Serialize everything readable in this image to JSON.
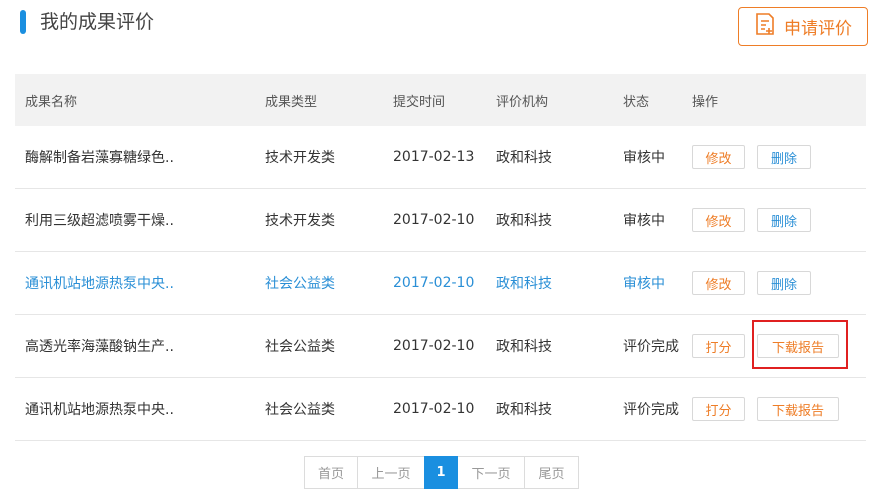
{
  "header": {
    "title": "我的成果评价",
    "apply_label": "申请评价"
  },
  "table": {
    "columns": [
      "成果名称",
      "成果类型",
      "提交时间",
      "评价机构",
      "状态",
      "操作"
    ],
    "rows": [
      {
        "name": "酶解制备岩藻寡糖绿色..",
        "type": "技术开发类",
        "date": "2017-02-13",
        "org": "政和科技",
        "status": "审核中",
        "actions": [
          "修改",
          "删除"
        ]
      },
      {
        "name": "利用三级超滤喷雾干燥..",
        "type": "技术开发类",
        "date": "2017-02-10",
        "org": "政和科技",
        "status": "审核中",
        "actions": [
          "修改",
          "删除"
        ]
      },
      {
        "name": "通讯机站地源热泵中央..",
        "type": "社会公益类",
        "date": "2017-02-10",
        "org": "政和科技",
        "status": "审核中",
        "actions": [
          "修改",
          "删除"
        ]
      },
      {
        "name": "高透光率海藻酸钠生产..",
        "type": "社会公益类",
        "date": "2017-02-10",
        "org": "政和科技",
        "status": "评价完成",
        "actions": [
          "打分",
          "下载报告"
        ]
      },
      {
        "name": "通讯机站地源热泵中央..",
        "type": "社会公益类",
        "date": "2017-02-10",
        "org": "政和科技",
        "status": "评价完成",
        "actions": [
          "打分",
          "下载报告"
        ]
      }
    ]
  },
  "pagination": {
    "first": "首页",
    "prev": "上一页",
    "current": "1",
    "next": "下一页",
    "last": "尾页"
  },
  "colors": {
    "accent_blue": "#1a8fe0",
    "accent_orange": "#ee7d27",
    "highlight_red": "#e02020"
  }
}
